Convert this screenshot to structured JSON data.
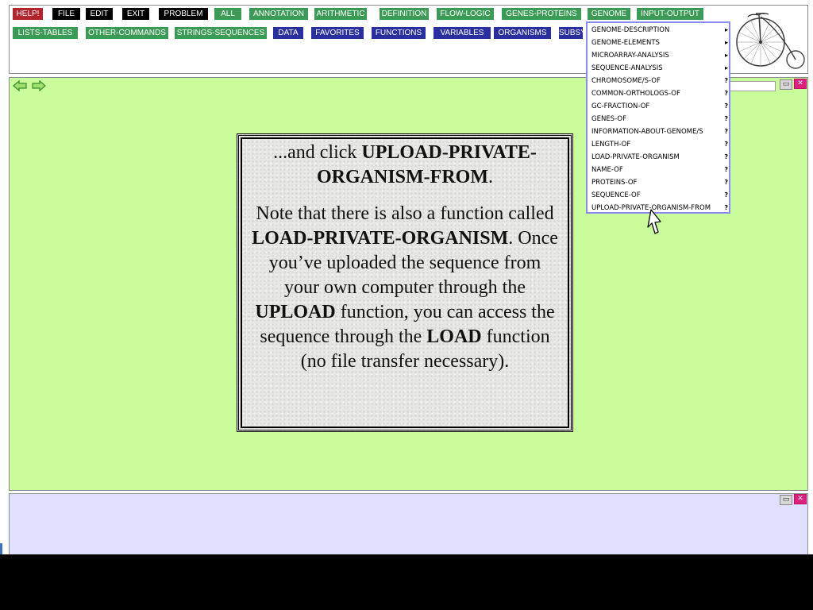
{
  "toolbar": {
    "row1": [
      {
        "label": "HELP!",
        "style": "red"
      },
      {
        "label": "FILE",
        "style": "black"
      },
      {
        "label": "EDIT",
        "style": "black"
      },
      {
        "label": "EXIT",
        "style": "black"
      },
      {
        "label": "PROBLEM",
        "style": "black"
      },
      {
        "label": "ALL",
        "style": "green"
      },
      {
        "label": "ANNOTATION",
        "style": "green"
      },
      {
        "label": "ARITHMETIC",
        "style": "green"
      },
      {
        "label": "DEFINITION",
        "style": "green"
      },
      {
        "label": "FLOW-LOGIC",
        "style": "green"
      },
      {
        "label": "GENES-PROTEINS",
        "style": "green"
      },
      {
        "label": "GENOME",
        "style": "green"
      },
      {
        "label": "INPUT-OUTPUT",
        "style": "green"
      }
    ],
    "row2": [
      {
        "label": "LISTS-TABLES",
        "style": "green"
      },
      {
        "label": "OTHER-COMMANDS",
        "style": "green"
      },
      {
        "label": "STRINGS-SEQUENCES",
        "style": "green"
      },
      {
        "label": "DATA",
        "style": "navy"
      },
      {
        "label": "FAVORITES",
        "style": "navy"
      },
      {
        "label": "FUNCTIONS",
        "style": "navy"
      },
      {
        "label": "VARIABLES",
        "style": "navy"
      },
      {
        "label": "ORGANISMS",
        "style": "navy"
      },
      {
        "label": "SUBSYSTEMS",
        "style": "navy"
      }
    ]
  },
  "genome_menu": {
    "items": [
      {
        "label": "GENOME-DESCRIPTION",
        "suffix": "▸"
      },
      {
        "label": "GENOME-ELEMENTS",
        "suffix": "▸"
      },
      {
        "label": "MICROARRAY-ANALYSIS",
        "suffix": "▸"
      },
      {
        "label": "SEQUENCE-ANALYSIS",
        "suffix": "▸"
      },
      {
        "label": "CHROMOSOME/S-OF",
        "suffix": "?"
      },
      {
        "label": "COMMON-ORTHOLOGS-OF",
        "suffix": "?"
      },
      {
        "label": "GC-FRACTION-OF",
        "suffix": "?"
      },
      {
        "label": "GENES-OF",
        "suffix": "?"
      },
      {
        "label": "INFORMATION-ABOUT-GENOME/S",
        "suffix": "?"
      },
      {
        "label": "LENGTH-OF",
        "suffix": "?"
      },
      {
        "label": "LOAD-PRIVATE-ORGANISM",
        "suffix": "?"
      },
      {
        "label": "NAME-OF",
        "suffix": "?"
      },
      {
        "label": "PROTEINS-OF",
        "suffix": "?"
      },
      {
        "label": "SEQUENCE-OF",
        "suffix": "?"
      },
      {
        "label": "UPLOAD-PRIVATE-ORGANISM-FROM",
        "suffix": "?"
      }
    ]
  },
  "note": {
    "p1_text1": "...and click ",
    "p1_bold1": "UPLOAD-PRIVATE-ORGANISM-FROM",
    "p1_text2": ".",
    "p2_text1": "Note that there is also a function called ",
    "p2_bold1": "LOAD-PRIVATE-ORGANISM",
    "p2_text2": ". Once you’ve uploaded the sequence from your own computer through the ",
    "p2_bold2": "UPLOAD",
    "p2_text3": " function, you can access the sequence through the ",
    "p2_bold3": "LOAD",
    "p2_text4": " function (no file transfer necessary)."
  },
  "window_controls": {
    "minimize_icon": "▭",
    "close_icon": "✕"
  },
  "colors": {
    "work_area": "#c9fd9c",
    "bottom_pane": "#e0e0ff",
    "menu_border": "#8c8cf0",
    "green_button": "#3b9a55",
    "navy_button": "#2a2fa0",
    "help_button": "#b3242b"
  }
}
